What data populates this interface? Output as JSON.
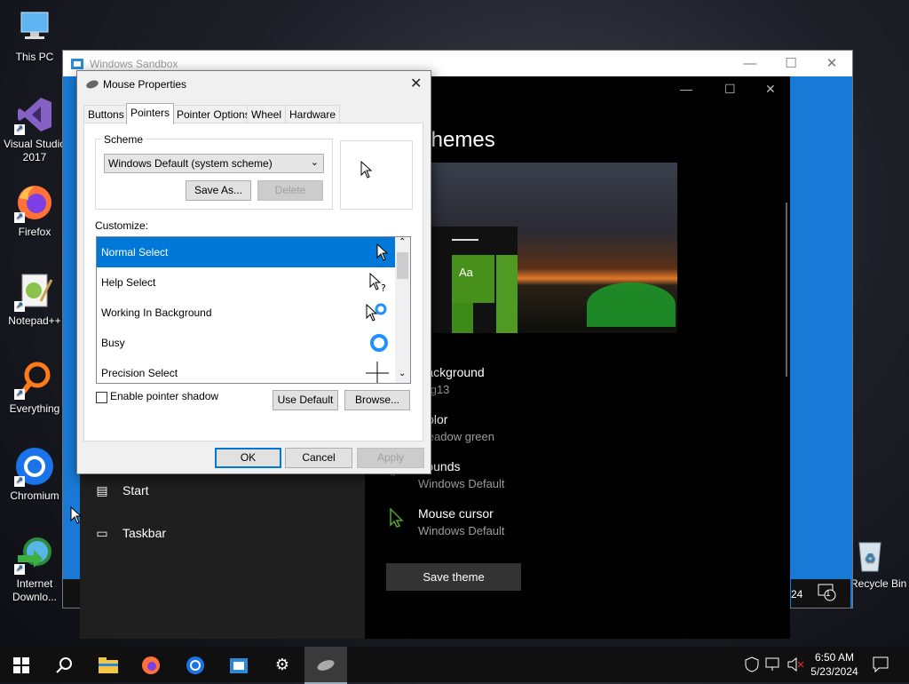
{
  "desktop": {
    "icons": [
      {
        "label": "This PC",
        "icon": "this-pc-icon"
      },
      {
        "label": "Visual Studio 2017",
        "icon": "visual-studio-icon"
      },
      {
        "label": "Firefox",
        "icon": "firefox-icon"
      },
      {
        "label": "Notepad++",
        "icon": "notepadpp-icon"
      },
      {
        "label": "Everything",
        "icon": "everything-icon"
      },
      {
        "label": "Chromium",
        "icon": "chromium-icon"
      },
      {
        "label": "Internet Downlo...",
        "icon": "idm-icon"
      },
      {
        "label": "Recycle Bin",
        "icon": "recycle-bin-icon"
      }
    ]
  },
  "sandbox": {
    "title": "Windows Sandbox",
    "taskbar_clock_fragment": "24",
    "notification_count": "1"
  },
  "settings": {
    "heading": "Themes",
    "nav": [
      {
        "label": "Start",
        "icon": "start-layout-icon"
      },
      {
        "label": "Taskbar",
        "icon": "taskbar-icon"
      }
    ],
    "preview_tile": "Aa",
    "items": [
      {
        "title": "Background",
        "sub": "img13"
      },
      {
        "title": "Color",
        "sub": "Meadow green"
      },
      {
        "title": "Sounds",
        "sub": "Windows Default"
      },
      {
        "title": "Mouse cursor",
        "sub": "Windows Default"
      }
    ],
    "save_button": "Save theme"
  },
  "mouse_dialog": {
    "title": "Mouse Properties",
    "tabs": [
      "Buttons",
      "Pointers",
      "Pointer Options",
      "Wheel",
      "Hardware"
    ],
    "active_tab": "Pointers",
    "scheme_label": "Scheme",
    "scheme_value": "Windows Default (system scheme)",
    "save_as": "Save As...",
    "delete": "Delete",
    "customize_label": "Customize:",
    "pointers": [
      {
        "label": "Normal Select",
        "cursor": "arrow"
      },
      {
        "label": "Help Select",
        "cursor": "help"
      },
      {
        "label": "Working In Background",
        "cursor": "working"
      },
      {
        "label": "Busy",
        "cursor": "busy"
      },
      {
        "label": "Precision Select",
        "cursor": "cross"
      }
    ],
    "selected_pointer": "Normal Select",
    "shadow_label": "Enable pointer shadow",
    "shadow_checked": false,
    "use_default": "Use Default",
    "browse": "Browse...",
    "ok": "OK",
    "cancel": "Cancel",
    "apply": "Apply"
  },
  "taskbar": {
    "time": "6:50 AM",
    "date": "5/23/2024",
    "apps": [
      "start-icon",
      "search-icon",
      "file-explorer-icon",
      "firefox-icon",
      "chromium-icon",
      "sandbox-icon",
      "settings-icon",
      "mouse-icon"
    ]
  }
}
